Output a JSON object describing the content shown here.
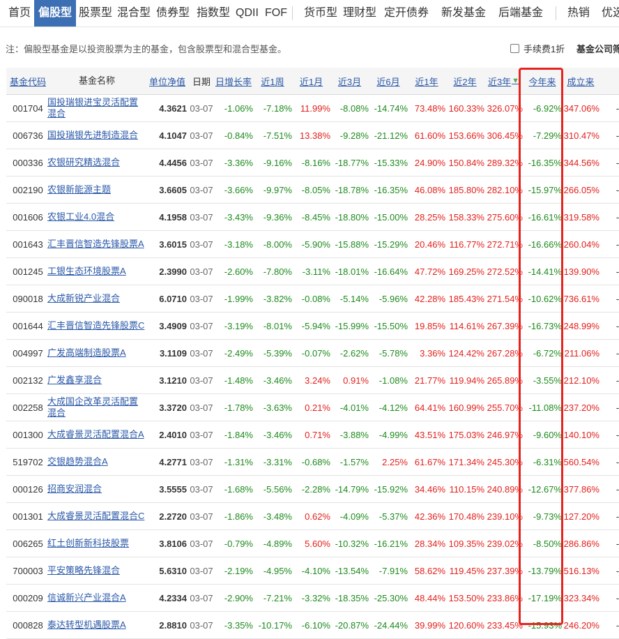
{
  "nav": {
    "items": [
      "首页",
      "偏股型",
      "股票型",
      "混合型",
      "债券型",
      "指数型",
      "QDII",
      "FOF",
      "货币型",
      "理财型",
      "定开债券",
      "新发基金",
      "后端基金",
      "热销",
      "优选"
    ],
    "active": "偏股型"
  },
  "note": "注：偏股型基金是以投资股票为主的基金，包含股票型和混合型基金。",
  "fee_label": "手续费1折",
  "company_label": "基金公司筛",
  "columns": {
    "code": "基金代码",
    "name": "基金名称",
    "nav": "单位净值",
    "date": "日期",
    "d1": "日增长率",
    "w1": "近1周",
    "m1": "近1月",
    "m3": "近3月",
    "m6": "近6月",
    "y1": "近1年",
    "y2": "近2年",
    "y3": "近3年",
    "ytd": "今年来",
    "since": "成立来"
  },
  "colors": {
    "nav_active_bg": "#3d6fb4",
    "positive": "#e3201c",
    "negative": "#1c8a1c",
    "highlight": "#e8231f"
  },
  "rows": [
    {
      "code": "001704",
      "name": "国投瑞银进宝灵活配置混合",
      "nav": "4.3621",
      "date": "03-07",
      "d1": "-1.06%",
      "w1": "-7.18%",
      "m1": "11.99%",
      "m3": "-8.08%",
      "m6": "-14.74%",
      "y1": "73.48%",
      "y2": "160.33%",
      "y3": "326.07%",
      "ytd": "-6.92%",
      "since": "347.06%",
      "dash": "-"
    },
    {
      "code": "006736",
      "name": "国投瑞银先进制造混合",
      "nav": "4.1047",
      "date": "03-07",
      "d1": "-0.84%",
      "w1": "-7.51%",
      "m1": "13.38%",
      "m3": "-9.28%",
      "m6": "-21.12%",
      "y1": "61.60%",
      "y2": "153.66%",
      "y3": "306.45%",
      "ytd": "-7.29%",
      "since": "310.47%",
      "dash": "-"
    },
    {
      "code": "000336",
      "name": "农银研究精选混合",
      "nav": "4.4456",
      "date": "03-07",
      "d1": "-3.36%",
      "w1": "-9.16%",
      "m1": "-8.16%",
      "m3": "-18.77%",
      "m6": "-15.33%",
      "y1": "24.90%",
      "y2": "150.84%",
      "y3": "289.32%",
      "ytd": "-16.35%",
      "since": "344.56%",
      "dash": "-"
    },
    {
      "code": "002190",
      "name": "农银新能源主题",
      "nav": "3.6605",
      "date": "03-07",
      "d1": "-3.66%",
      "w1": "-9.97%",
      "m1": "-8.05%",
      "m3": "-18.78%",
      "m6": "-16.35%",
      "y1": "46.08%",
      "y2": "185.80%",
      "y3": "282.10%",
      "ytd": "-15.97%",
      "since": "266.05%",
      "dash": "-"
    },
    {
      "code": "001606",
      "name": "农银工业4.0混合",
      "nav": "4.1958",
      "date": "03-07",
      "d1": "-3.43%",
      "w1": "-9.36%",
      "m1": "-8.45%",
      "m3": "-18.80%",
      "m6": "-15.00%",
      "y1": "28.25%",
      "y2": "158.33%",
      "y3": "275.60%",
      "ytd": "-16.61%",
      "since": "319.58%",
      "dash": "-"
    },
    {
      "code": "001643",
      "name": "汇丰晋信智造先锋股票A",
      "nav": "3.6015",
      "date": "03-07",
      "d1": "-3.18%",
      "w1": "-8.00%",
      "m1": "-5.90%",
      "m3": "-15.88%",
      "m6": "-15.29%",
      "y1": "20.46%",
      "y2": "116.77%",
      "y3": "272.71%",
      "ytd": "-16.66%",
      "since": "260.04%",
      "dash": "-"
    },
    {
      "code": "001245",
      "name": "工银生态环境股票A",
      "nav": "2.3990",
      "date": "03-07",
      "d1": "-2.60%",
      "w1": "-7.80%",
      "m1": "-3.11%",
      "m3": "-18.01%",
      "m6": "-16.64%",
      "y1": "47.72%",
      "y2": "169.25%",
      "y3": "272.52%",
      "ytd": "-14.41%",
      "since": "139.90%",
      "dash": "-"
    },
    {
      "code": "090018",
      "name": "大成新锐产业混合",
      "nav": "6.0710",
      "date": "03-07",
      "d1": "-1.99%",
      "w1": "-3.82%",
      "m1": "-0.08%",
      "m3": "-5.14%",
      "m6": "-5.96%",
      "y1": "42.28%",
      "y2": "185.43%",
      "y3": "271.54%",
      "ytd": "-10.62%",
      "since": "736.61%",
      "dash": "-"
    },
    {
      "code": "001644",
      "name": "汇丰晋信智造先锋股票C",
      "nav": "3.4909",
      "date": "03-07",
      "d1": "-3.19%",
      "w1": "-8.01%",
      "m1": "-5.94%",
      "m3": "-15.99%",
      "m6": "-15.50%",
      "y1": "19.85%",
      "y2": "114.61%",
      "y3": "267.39%",
      "ytd": "-16.73%",
      "since": "248.99%",
      "dash": "-"
    },
    {
      "code": "004997",
      "name": "广发高端制造股票A",
      "nav": "3.1109",
      "date": "03-07",
      "d1": "-2.49%",
      "w1": "-5.39%",
      "m1": "-0.07%",
      "m3": "-2.62%",
      "m6": "-5.78%",
      "y1": "3.36%",
      "y2": "124.42%",
      "y3": "267.28%",
      "ytd": "-6.72%",
      "since": "211.06%",
      "dash": "-"
    },
    {
      "code": "002132",
      "name": "广发鑫享混合",
      "nav": "3.1210",
      "date": "03-07",
      "d1": "-1.48%",
      "w1": "-3.46%",
      "m1": "3.24%",
      "m3": "0.91%",
      "m6": "-1.08%",
      "y1": "21.77%",
      "y2": "119.94%",
      "y3": "265.89%",
      "ytd": "-3.55%",
      "since": "212.10%",
      "dash": "-"
    },
    {
      "code": "002258",
      "name": "大成国企改革灵活配置混合",
      "nav": "3.3720",
      "date": "03-07",
      "d1": "-1.78%",
      "w1": "-3.63%",
      "m1": "0.21%",
      "m3": "-4.01%",
      "m6": "-4.12%",
      "y1": "64.41%",
      "y2": "160.99%",
      "y3": "255.70%",
      "ytd": "-11.08%",
      "since": "237.20%",
      "dash": "-"
    },
    {
      "code": "001300",
      "name": "大成睿景灵活配置混合A",
      "nav": "2.4010",
      "date": "03-07",
      "d1": "-1.84%",
      "w1": "-3.46%",
      "m1": "0.71%",
      "m3": "-3.88%",
      "m6": "-4.99%",
      "y1": "43.51%",
      "y2": "175.03%",
      "y3": "246.97%",
      "ytd": "-9.60%",
      "since": "140.10%",
      "dash": "-"
    },
    {
      "code": "519702",
      "name": "交银趋势混合A",
      "nav": "4.2771",
      "date": "03-07",
      "d1": "-1.31%",
      "w1": "-3.31%",
      "m1": "-0.68%",
      "m3": "-1.57%",
      "m6": "2.25%",
      "y1": "61.67%",
      "y2": "171.34%",
      "y3": "245.30%",
      "ytd": "-6.31%",
      "since": "560.54%",
      "dash": "-"
    },
    {
      "code": "000126",
      "name": "招商安润混合",
      "nav": "3.5555",
      "date": "03-07",
      "d1": "-1.68%",
      "w1": "-5.56%",
      "m1": "-2.28%",
      "m3": "-14.79%",
      "m6": "-15.92%",
      "y1": "34.46%",
      "y2": "110.15%",
      "y3": "240.89%",
      "ytd": "-12.67%",
      "since": "377.86%",
      "dash": "-"
    },
    {
      "code": "001301",
      "name": "大成睿景灵活配置混合C",
      "nav": "2.2720",
      "date": "03-07",
      "d1": "-1.86%",
      "w1": "-3.48%",
      "m1": "0.62%",
      "m3": "-4.09%",
      "m6": "-5.37%",
      "y1": "42.36%",
      "y2": "170.48%",
      "y3": "239.10%",
      "ytd": "-9.73%",
      "since": "127.20%",
      "dash": "-"
    },
    {
      "code": "006265",
      "name": "红土创新新科技股票",
      "nav": "3.8106",
      "date": "03-07",
      "d1": "-0.79%",
      "w1": "-4.89%",
      "m1": "5.60%",
      "m3": "-10.32%",
      "m6": "-16.21%",
      "y1": "28.34%",
      "y2": "109.35%",
      "y3": "239.02%",
      "ytd": "-8.50%",
      "since": "286.86%",
      "dash": "-"
    },
    {
      "code": "700003",
      "name": "平安策略先锋混合",
      "nav": "5.6310",
      "date": "03-07",
      "d1": "-2.19%",
      "w1": "-4.95%",
      "m1": "-4.10%",
      "m3": "-13.54%",
      "m6": "-7.91%",
      "y1": "58.62%",
      "y2": "119.45%",
      "y3": "237.39%",
      "ytd": "-13.79%",
      "since": "516.13%",
      "dash": "-"
    },
    {
      "code": "000209",
      "name": "信诚新兴产业混合A",
      "nav": "4.2334",
      "date": "03-07",
      "d1": "-2.90%",
      "w1": "-7.21%",
      "m1": "-3.32%",
      "m3": "-18.35%",
      "m6": "-25.30%",
      "y1": "48.44%",
      "y2": "153.50%",
      "y3": "233.86%",
      "ytd": "-17.19%",
      "since": "323.34%",
      "dash": "-"
    },
    {
      "code": "000828",
      "name": "泰达转型机遇股票A",
      "nav": "2.8810",
      "date": "03-07",
      "d1": "-3.35%",
      "w1": "-10.17%",
      "m1": "-6.10%",
      "m3": "-20.87%",
      "m6": "-24.44%",
      "y1": "39.99%",
      "y2": "120.60%",
      "y3": "233.45%",
      "ytd": "-15.93%",
      "since": "246.20%",
      "dash": "-"
    }
  ]
}
